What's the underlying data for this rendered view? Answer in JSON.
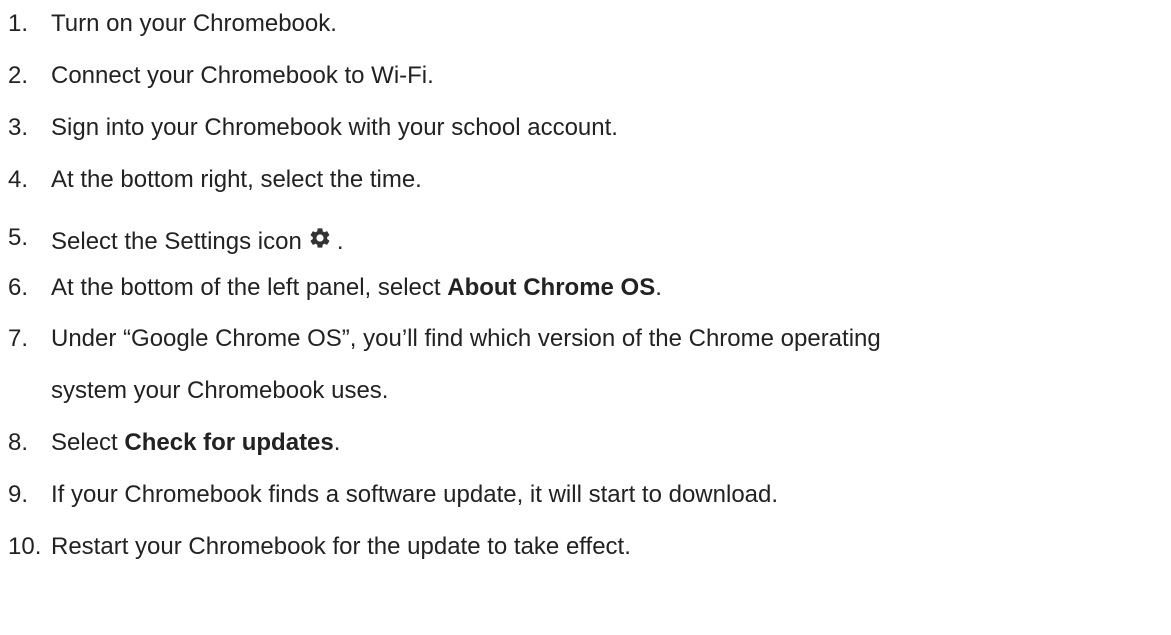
{
  "steps": [
    {
      "num": "1.",
      "text": "Turn on your Chromebook."
    },
    {
      "num": "2.",
      "text": "Connect your Chromebook to Wi-Fi."
    },
    {
      "num": "3.",
      "text": "Sign into your Chromebook with your school account."
    },
    {
      "num": "4.",
      "text": "At the bottom right, select the time."
    },
    {
      "num": "5.",
      "text": "Select the Settings icon",
      "after_icon": ".",
      "icon": "settings-gear-icon"
    },
    {
      "num": "6.",
      "text": "At the bottom of the left panel, select ",
      "bold": "About Chrome OS",
      "after": "."
    },
    {
      "num": "7.",
      "text": "Under “Google Chrome OS”, you’ll find which version of the Chrome operating",
      "continuation": "system your Chromebook uses."
    },
    {
      "num": "8.",
      "text": "Select ",
      "bold": "Check for updates",
      "after": "."
    },
    {
      "num": "9.",
      "text": "If your Chromebook finds a software update, it will start to download."
    },
    {
      "num": "10.",
      "text": "Restart your Chromebook for the update to take effect."
    }
  ]
}
